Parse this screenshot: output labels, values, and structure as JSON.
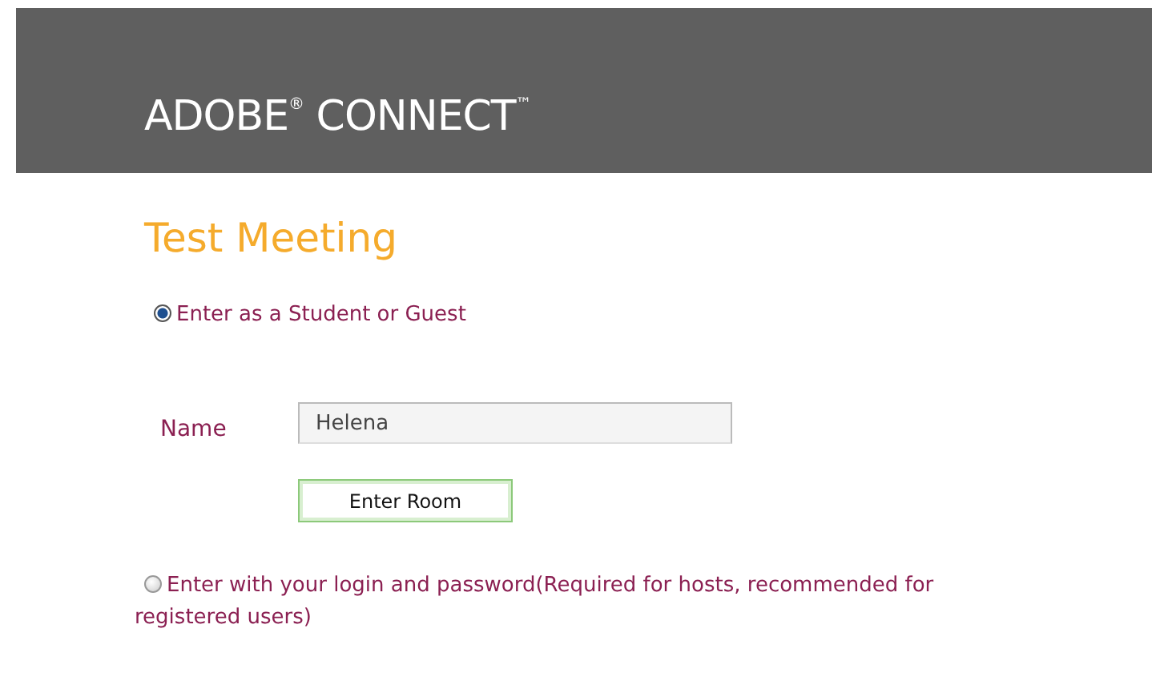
{
  "header": {
    "logo": "ADOBE$^{®}$ CONNECT$^{™}$"
  },
  "meeting_title": "Test Meeting",
  "entry_options": [
    {
      "label": "Enter as a Student or Guest",
      "selected": true
    },
    {
      "label": "Enter with your login and password(Required for hosts, recommended for registered users)",
      "selected": false
    }
  ],
  "name_field": {
    "label": "Name",
    "value": "Helena"
  },
  "enter_button": "Enter Room"
}
